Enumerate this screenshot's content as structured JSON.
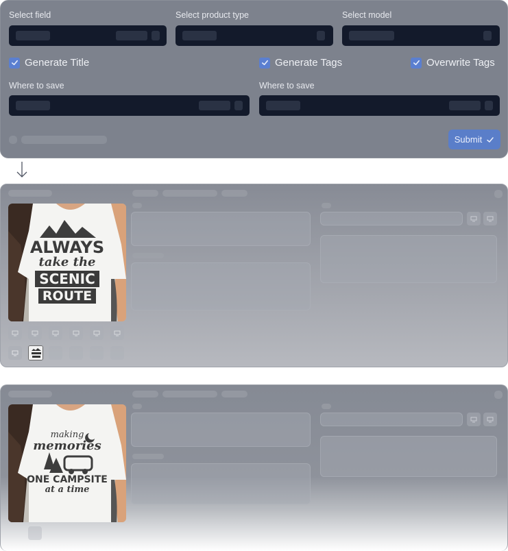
{
  "form": {
    "select_field_label": "Select field",
    "select_product_type_label": "Select product type",
    "select_model_label": "Select model",
    "generate_title_label": "Generate Title",
    "generate_tags_label": "Generate Tags",
    "overwrite_tags_label": "Overwrite Tags",
    "where_to_save_label_1": "Where to save",
    "where_to_save_label_2": "Where to save",
    "submit_label": "Submit",
    "generate_title_checked": true,
    "generate_tags_checked": true,
    "overwrite_tags_checked": true
  },
  "products": [
    {
      "design_lines": [
        "ALWAYS",
        "take the",
        "SCENIC",
        "ROUTE"
      ]
    },
    {
      "design_lines": [
        "making",
        "memories",
        "ONE CAMPSITE",
        "at a time"
      ]
    }
  ],
  "colors": {
    "accent": "#5a7ec9",
    "select_bg": "#131a2b",
    "panel_bg": "#7d828d"
  }
}
